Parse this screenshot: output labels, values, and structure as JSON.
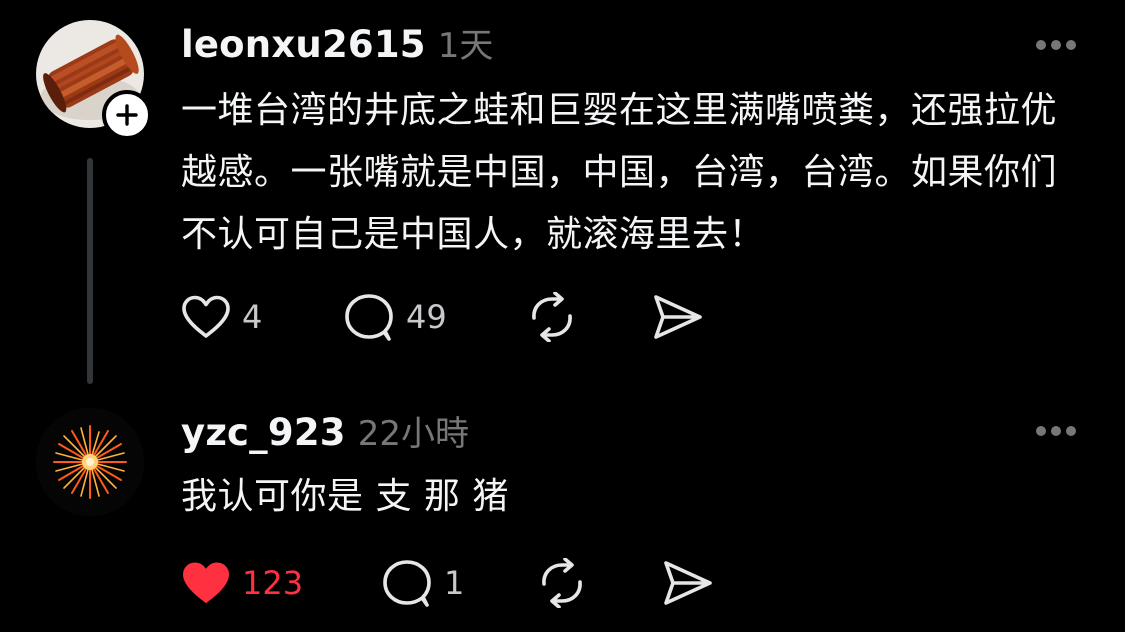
{
  "comments": [
    {
      "username": "leonxu2615",
      "time": "1天",
      "text": "一堆台湾的井底之蛙和巨婴在这里满嘴喷粪，还强拉优越感。一张嘴就是中国，中国，台湾，台湾。如果你们不认可自己是中国人，就滚海里去！",
      "likes": "4",
      "replies": "49",
      "liked": false,
      "avatar_icon": "copper-wire-spool-photo",
      "has_follow_button": true
    },
    {
      "username": "yzc_923",
      "time": "22小時",
      "text": "我认可你是 支 那 猪",
      "likes": "123",
      "replies": "1",
      "liked": true,
      "avatar_icon": "firework-photo",
      "has_follow_button": false
    }
  ],
  "icons": {
    "more": "more-horizontal-icon",
    "like": "heart-icon",
    "reply": "speech-bubble-icon",
    "repost": "repost-icon",
    "share": "send-icon",
    "follow": "plus-icon"
  },
  "colors": {
    "background": "#000000",
    "text": "#f3f5f7",
    "secondary": "#777777",
    "like_active": "#ff3040",
    "thread_line": "#333638"
  }
}
